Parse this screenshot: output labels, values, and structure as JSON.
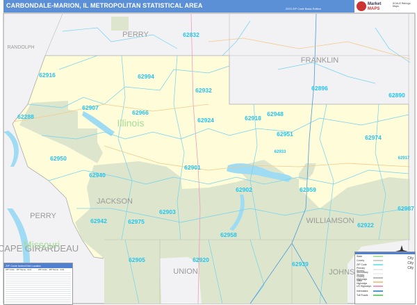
{
  "header": {
    "title": "CARBONDALE-MARION, IL METROPOLITAN STATISTICAL AREA",
    "edition": "2023 ZIP Code Basic Edition",
    "logo_line1": "Market",
    "logo_line2": "MAPS",
    "logo_side": "SCALE Ratings Maps"
  },
  "zips": [
    "62832",
    "62916",
    "62994",
    "62932",
    "62896",
    "62890",
    "62907",
    "62966",
    "62924",
    "62918",
    "62948",
    "62288",
    "62951",
    "62974",
    "62933",
    "62917",
    "62950",
    "62901",
    "62940",
    "62902",
    "62959",
    "62903",
    "62942",
    "62975",
    "62987",
    "62922",
    "62958",
    "62905",
    "62920",
    "62939"
  ],
  "counties": [
    "PERRY",
    "RANDOLPH",
    "FRANKLIN",
    "JACKSON",
    "WILLIAMSON",
    "PERRY",
    "CAPE GIRARDEAU",
    "UNION",
    "JOHNSON"
  ],
  "states": [
    "Illinois",
    "Missouri"
  ],
  "index": {
    "title": "ZIP Code Index/Grid Locator",
    "columns": [
      "ZIP Code",
      "ZIP Name",
      "Grid",
      "ZIP Code",
      "ZIP Name",
      "Grid"
    ]
  },
  "legend": {
    "items": [
      {
        "label": "State",
        "color": "#a8e6a0"
      },
      {
        "label": "County",
        "color": "#cccccc"
      },
      {
        "label": "ZIP Code",
        "color": "#7fe3f2"
      },
      {
        "label": "Primary Streets",
        "color": "#e8e8e8"
      },
      {
        "label": "Secondary Streets",
        "color": "#f0f0f0"
      },
      {
        "label": "County Highways",
        "color": "#bbbbbb"
      },
      {
        "label": "State Highways",
        "color": "#f3c98a"
      },
      {
        "label": "US Highways",
        "color": "#f29ac0"
      },
      {
        "label": "Interstates",
        "color": "#4a9bd8"
      },
      {
        "label": "Toll Roads",
        "color": "#6fd06f"
      }
    ],
    "city_sample": "City"
  },
  "colors": {
    "msa_fill": "#fffcd9",
    "outside_fill": "#f2f2f4",
    "forest": "#dde6cc",
    "water": "#9fdcf3",
    "zip_line": "#6fd3ef",
    "header": "#5b8fd6"
  }
}
